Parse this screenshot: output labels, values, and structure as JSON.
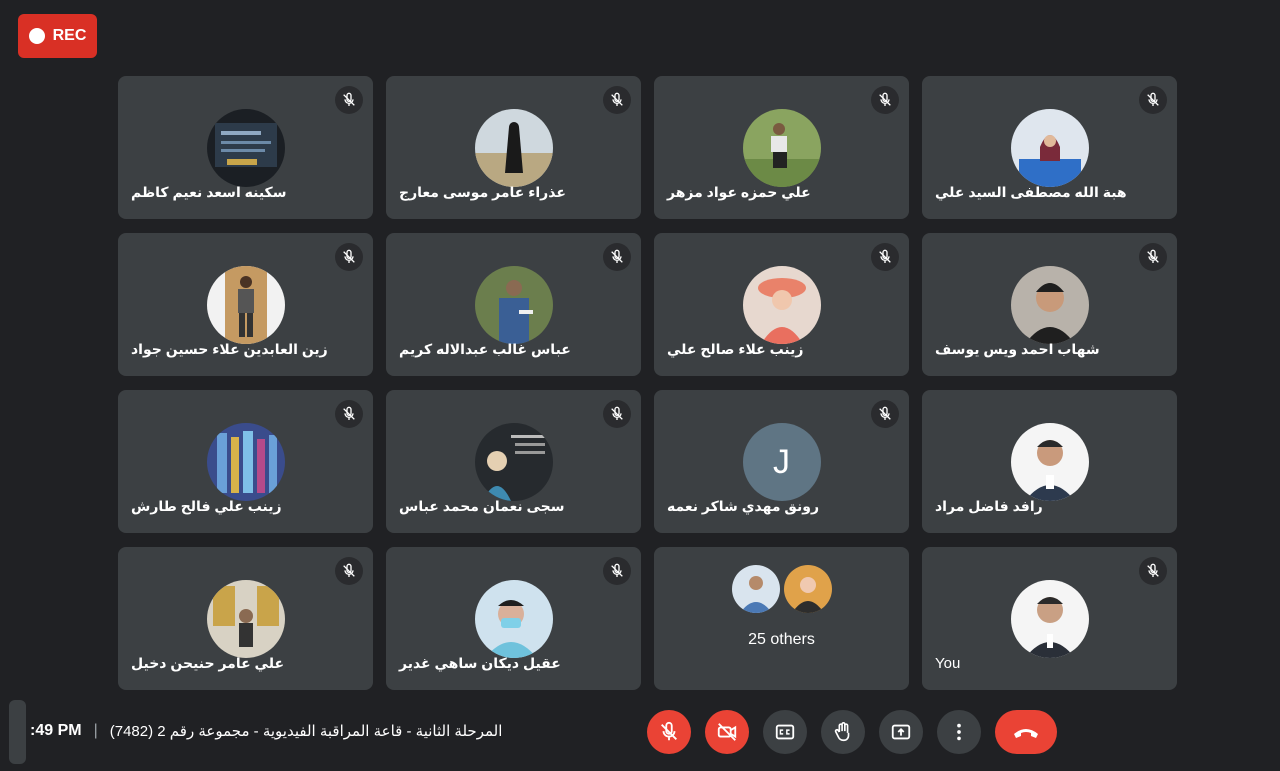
{
  "rec_label": "REC",
  "colors": {
    "background": "#202124",
    "tile": "#3c4043",
    "danger": "#ea4335",
    "rec": "#d93025"
  },
  "participants": [
    {
      "name": "سكينه اسعد نعيم كاظم",
      "muted": true
    },
    {
      "name": "عذراء عامر موسى معارج",
      "muted": true
    },
    {
      "name": "علي حمزه عواد مزهر",
      "muted": true
    },
    {
      "name": "هبة الله مصطفى السيد علي",
      "muted": true
    },
    {
      "name": "زين العابدين علاء حسين جواد",
      "muted": true
    },
    {
      "name": "عباس غالب عبدالاله كريم",
      "muted": true
    },
    {
      "name": "زينب علاء صالح علي",
      "muted": true
    },
    {
      "name": "شهاب احمد ويس يوسف",
      "muted": true
    },
    {
      "name": "زينب علي فالح طارش",
      "muted": true
    },
    {
      "name": "سجى نعمان محمد عباس",
      "muted": true
    },
    {
      "name": "رونق مهدي شاكر نعمه",
      "muted": true,
      "initial": "J"
    },
    {
      "name": "رافد فاضل مراد",
      "muted": false
    },
    {
      "name": "علي عامر حنيحن دخيل",
      "muted": true
    },
    {
      "name": "عقيل ديكان ساهي غدير",
      "muted": true
    },
    {
      "others_label": "25 others"
    },
    {
      "name": "You",
      "muted": true
    }
  ],
  "bottom": {
    "time": ":49 PM",
    "separator": "|",
    "meeting_title": "المرحلة الثانية - قاعة المراقبة الفيديوية - مجموعة رقم 2 (7482)"
  },
  "controls": [
    "mic-off-icon",
    "camera-off-icon",
    "captions-icon",
    "raise-hand-icon",
    "present-icon",
    "more-options-icon",
    "end-call-icon"
  ]
}
